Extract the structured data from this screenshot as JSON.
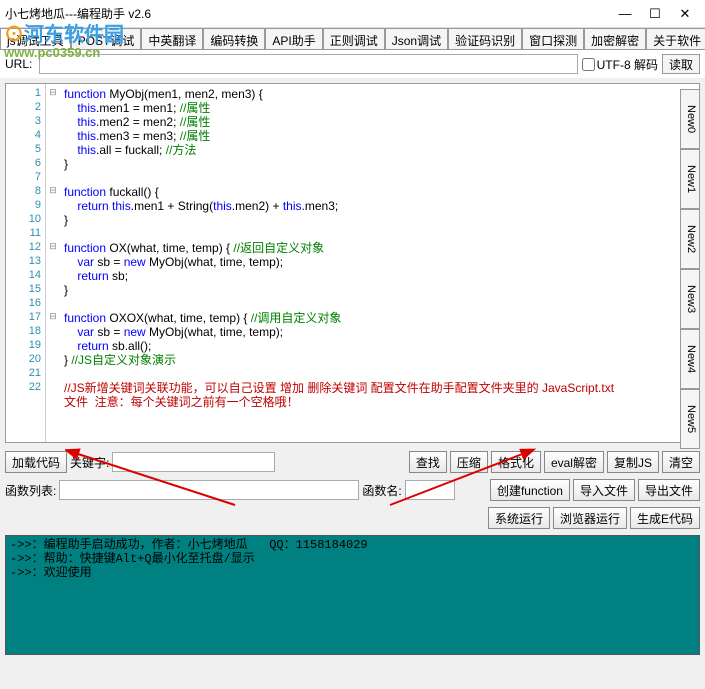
{
  "title": "小七烤地瓜---编程助手 v2.6",
  "watermark": {
    "line1a": "⊙",
    "line1b": "河东软件园",
    "line2": "www.pc0359.cn"
  },
  "winbtns": {
    "min": "—",
    "max": "☐",
    "close": "✕"
  },
  "tabs": [
    "js调试工具",
    "POST调试",
    "中英翻译",
    "编码转换",
    "API助手",
    "正则调试",
    "Json调试",
    "验证码识别",
    "窗口探测",
    "加密解密",
    "关于软件"
  ],
  "urlrow": {
    "label": "URL:",
    "value": "",
    "utf8": "UTF-8 解码",
    "read": "读取"
  },
  "code_lines": [
    {
      "n": 1,
      "f": "⊟",
      "html": "<span class='kw'>function</span> MyObj(men1, men2, men3) {"
    },
    {
      "n": 2,
      "f": "",
      "html": "    <span class='kw'>this</span>.men1 = men1; <span class='com'>//属性</span>"
    },
    {
      "n": 3,
      "f": "",
      "html": "    <span class='kw'>this</span>.men2 = men2; <span class='com'>//属性</span>"
    },
    {
      "n": 4,
      "f": "",
      "html": "    <span class='kw'>this</span>.men3 = men3; <span class='com'>//属性</span>"
    },
    {
      "n": 5,
      "f": "",
      "html": "    <span class='kw'>this</span>.all = fuckall; <span class='com'>//方法</span>"
    },
    {
      "n": 6,
      "f": "",
      "html": "}"
    },
    {
      "n": 7,
      "f": "",
      "html": ""
    },
    {
      "n": 8,
      "f": "⊟",
      "html": "<span class='kw'>function</span> fuckall() {"
    },
    {
      "n": 9,
      "f": "",
      "html": "    <span class='kw'>return</span> <span class='kw'>this</span>.men1 + String(<span class='kw'>this</span>.men2) + <span class='kw'>this</span>.men3;"
    },
    {
      "n": 10,
      "f": "",
      "html": "}"
    },
    {
      "n": 11,
      "f": "",
      "html": ""
    },
    {
      "n": 12,
      "f": "⊟",
      "html": "<span class='kw'>function</span> OX(what, time, temp) { <span class='com'>//返回自定义对象</span>"
    },
    {
      "n": 13,
      "f": "",
      "html": "    <span class='kw'>var</span> sb = <span class='kw'>new</span> MyObj(what, time, temp);"
    },
    {
      "n": 14,
      "f": "",
      "html": "    <span class='kw'>return</span> sb;"
    },
    {
      "n": 15,
      "f": "",
      "html": "}"
    },
    {
      "n": 16,
      "f": "",
      "html": ""
    },
    {
      "n": 17,
      "f": "⊟",
      "html": "<span class='kw'>function</span> OXOX(what, time, temp) { <span class='com'>//调用自定义对象</span>"
    },
    {
      "n": 18,
      "f": "",
      "html": "    <span class='kw'>var</span> sb = <span class='kw'>new</span> MyObj(what, time, temp);"
    },
    {
      "n": 19,
      "f": "",
      "html": "    <span class='kw'>return</span> sb.all();"
    },
    {
      "n": 20,
      "f": "",
      "html": "} <span class='com'>//JS自定义对象演示</span>"
    },
    {
      "n": 21,
      "f": "",
      "html": ""
    },
    {
      "n": 22,
      "f": "",
      "html": "<span class='comred'>//JS新增关键词关联功能，可以自己设置 增加 删除关键词 配置文件在助手配置文件夹里的 JavaScript.txt<br>文件  注意：每个关键词之前有一个空格哦！</span>"
    }
  ],
  "sidetabs": [
    "New0",
    "New1",
    "New2",
    "New3",
    "New4",
    "New5"
  ],
  "row1": {
    "load": "加载代码",
    "kwlbl": "关键字:",
    "kwval": "",
    "find": "查找",
    "compress": "压缩",
    "format": "格式化",
    "eval": "eval解密",
    "copy": "复制JS",
    "clear": "清空"
  },
  "row2": {
    "listlbl": "函数列表:",
    "listval": "",
    "namelbl": "函数名:",
    "nameval": "",
    "createfn": "创建function",
    "import": "导入文件",
    "export": "导出文件"
  },
  "row3": {
    "sysrun": "系统运行",
    "browserrun": "浏览器运行",
    "gene": "生成E代码"
  },
  "console_lines": [
    "->>：编程助手启动成功，作者：小七烤地瓜   QQ：1158184029",
    "->>：帮助：快捷键Alt+Q最小化至托盘/显示",
    "->>：欢迎使用"
  ]
}
